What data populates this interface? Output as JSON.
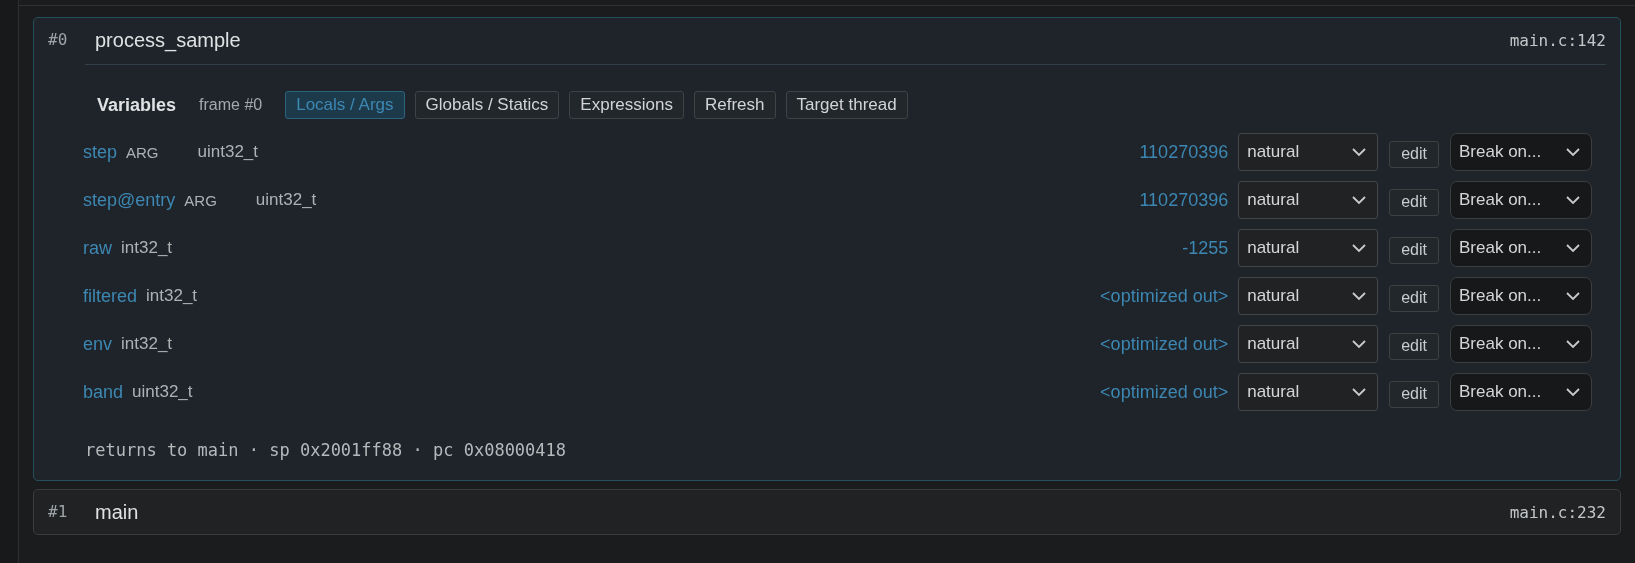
{
  "frames": [
    {
      "index": "#0",
      "function": "process_sample",
      "location": "main.c:142",
      "expanded": true,
      "variables": {
        "title": "Variables",
        "frame_label": "frame #0",
        "tabs": [
          {
            "label": "Locals / Args",
            "selected": true
          },
          {
            "label": "Globals / Statics",
            "selected": false
          },
          {
            "label": "Expressions",
            "selected": false
          },
          {
            "label": "Refresh",
            "selected": false
          },
          {
            "label": "Target thread",
            "selected": false
          }
        ],
        "rows": [
          {
            "name": "step",
            "tag": "ARG",
            "type": "uint32_t",
            "value": "110270396",
            "format": "natural",
            "edit": "edit",
            "break": "Break on..."
          },
          {
            "name": "step@entry",
            "tag": "ARG",
            "type": "uint32_t",
            "value": "110270396",
            "format": "natural",
            "edit": "edit",
            "break": "Break on..."
          },
          {
            "name": "raw",
            "type": "int32_t",
            "value": "-1255",
            "format": "natural",
            "edit": "edit",
            "break": "Break on..."
          },
          {
            "name": "filtered",
            "type": "int32_t",
            "value": "<optimized out>",
            "format": "natural",
            "edit": "edit",
            "break": "Break on..."
          },
          {
            "name": "env",
            "type": "int32_t",
            "value": "<optimized out>",
            "format": "natural",
            "edit": "edit",
            "break": "Break on..."
          },
          {
            "name": "band",
            "type": "uint32_t",
            "value": "<optimized out>",
            "format": "natural",
            "edit": "edit",
            "break": "Break on..."
          }
        ],
        "footer": "returns to main · sp 0x2001ff88 · pc 0x08000418"
      }
    },
    {
      "index": "#1",
      "function": "main",
      "location": "main.c:232",
      "expanded": false
    }
  ]
}
